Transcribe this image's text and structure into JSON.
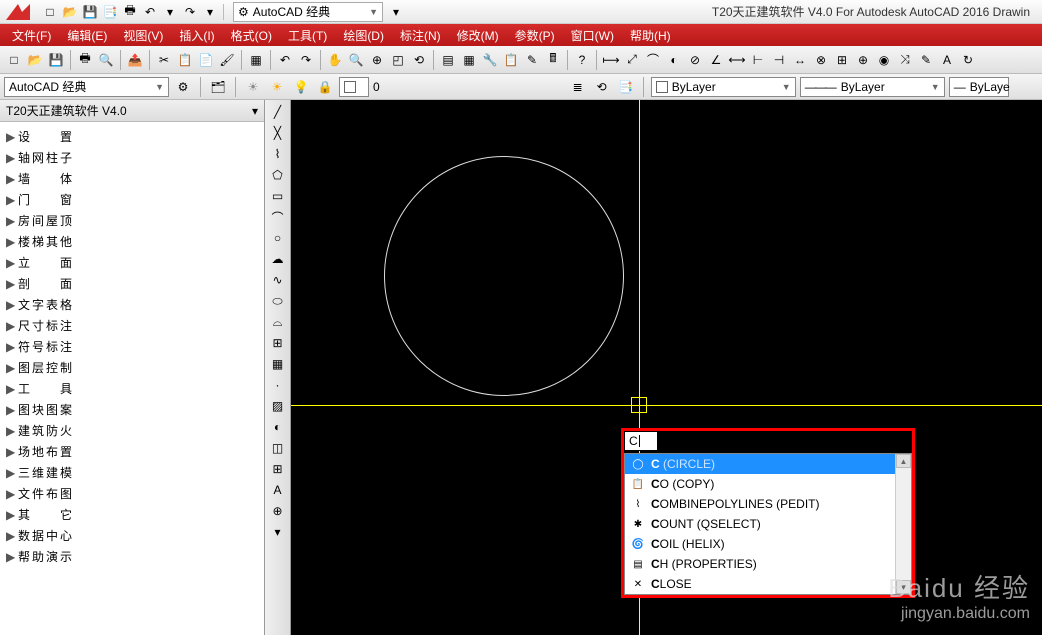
{
  "title_bar": {
    "workspace_label": "AutoCAD 经典",
    "app_title": "T20天正建筑软件 V4.0 For Autodesk AutoCAD 2016   Drawin"
  },
  "menu": {
    "items": [
      "文件(F)",
      "编辑(E)",
      "视图(V)",
      "插入(I)",
      "格式(O)",
      "工具(T)",
      "绘图(D)",
      "标注(N)",
      "修改(M)",
      "参数(P)",
      "窗口(W)",
      "帮助(H)"
    ]
  },
  "props_bar": {
    "workspace": "AutoCAD 经典",
    "layer_zero": "0",
    "bylayer1": "ByLayer",
    "bylayer2": "ByLayer",
    "bylayer3": "ByLaye"
  },
  "side_panel": {
    "title": "T20天正建筑软件 V4.0",
    "items": [
      "设　　置",
      "轴网柱子",
      "墙　　体",
      "门　　窗",
      "房间屋顶",
      "楼梯其他",
      "立　　面",
      "剖　　面",
      "文字表格",
      "尺寸标注",
      "符号标注",
      "图层控制",
      "工　　具",
      "图块图案",
      "建筑防火",
      "场地布置",
      "三维建模",
      "文件布图",
      "其　　它",
      "数据中心",
      "帮助演示"
    ]
  },
  "command": {
    "input": "C",
    "suggestions": [
      {
        "prefix": "C",
        "rest": " (CIRCLE)",
        "selected": true
      },
      {
        "prefix": "C",
        "rest": "O (COPY)",
        "selected": false
      },
      {
        "prefix": "C",
        "rest": "OMBINEPOLYLINES (PEDIT)",
        "selected": false
      },
      {
        "prefix": "C",
        "rest": "OUNT (QSELECT)",
        "selected": false
      },
      {
        "prefix": "C",
        "rest": "OIL (HELIX)",
        "selected": false
      },
      {
        "prefix": "C",
        "rest": "H (PROPERTIES)",
        "selected": false
      },
      {
        "prefix": "C",
        "rest": "LOSE",
        "selected": false
      }
    ]
  },
  "watermark": {
    "line1": "Baidu 经验",
    "line2": "jingyan.baidu.com"
  }
}
